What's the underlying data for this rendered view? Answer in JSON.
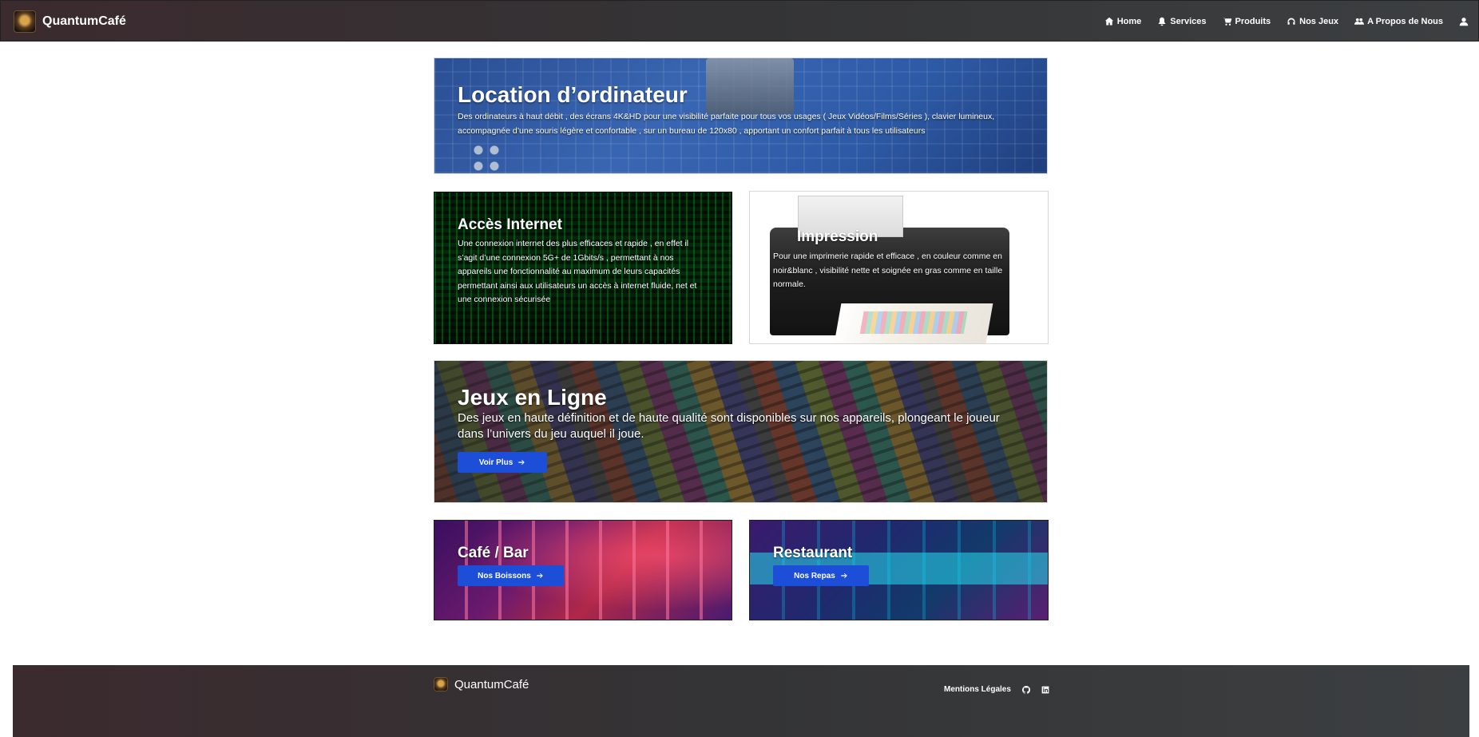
{
  "brand": {
    "name": "QuantumCafé"
  },
  "nav": {
    "items": [
      {
        "label": "Home",
        "icon": "home-icon"
      },
      {
        "label": "Services",
        "icon": "bell-icon"
      },
      {
        "label": "Produits",
        "icon": "cart-icon"
      },
      {
        "label": "Nos Jeux",
        "icon": "headphones-icon"
      },
      {
        "label": "A Propos de Nous",
        "icon": "users-icon"
      }
    ],
    "account_icon": "user-icon"
  },
  "cards": {
    "location": {
      "title": "Location d’ordinateur",
      "text": "Des ordinateurs à haut débit , des écrans 4K&HD pour une visibilité parfaite pour tous vos usages ( Jeux Vidéos/Films/Séries ), clavier lumineux, accompagnée d’une souris légère et confortable , sur un bureau de 120x80 , apportant un confort parfait à tous les utilisateurs"
    },
    "internet": {
      "title": "Accès Internet",
      "text": "Une connexion internet des plus efficaces et rapide , en effet il s’agit d’une connexion 5G+ de 1Gbits/s , permettant à nos appareils une fonctionnalité au maximum de leurs capacités permettant ainsi aux utilisateurs un accès à internet fluide, net et une connexion sécurisée"
    },
    "impression": {
      "title": "Impression",
      "text": "Pour une imprimerie rapide et efficace , en couleur comme en noir&blanc , visibilité nette et soignée en gras comme en taille normale."
    },
    "jeux": {
      "title": "Jeux en Ligne",
      "text": "Des jeux en haute définition et de haute qualité sont disponibles sur nos appareils, plongeant le joueur dans l’univers du jeu auquel il joue.",
      "button": "Voir Plus"
    },
    "cafe": {
      "title": "Café / Bar",
      "button": "Nos Boissons"
    },
    "restaurant": {
      "title": "Restaurant",
      "button": "Nos Repas"
    }
  },
  "footer": {
    "brand": "QuantumCafé",
    "legal": "Mentions Légales",
    "icons": [
      "github-icon",
      "linkedin-icon"
    ]
  },
  "colors": {
    "accent_button": "#1d4ed8",
    "nav_bg_start": "#3b2a2e",
    "nav_bg_end": "#3c3f41"
  }
}
